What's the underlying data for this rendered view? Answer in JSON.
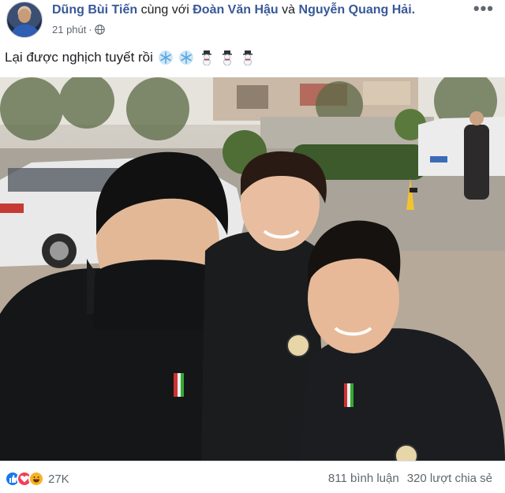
{
  "post": {
    "author": "Dũng Bùi Tiến",
    "with_text": "cùng với",
    "tagged_1": "Đoàn Văn Hậu",
    "and_text": "và",
    "tagged_2": "Nguyễn Quang Hải.",
    "time": "21 phút",
    "privacy_icon": "globe-icon",
    "more_icon": "more-options-icon",
    "text": "Lại được nghịch tuyết rồi",
    "emojis": [
      "snowflake-icon",
      "snowflake-icon",
      "snowman-icon",
      "snowman-icon",
      "snowman-icon"
    ]
  },
  "photo": {
    "description_icon": "selfie-photo"
  },
  "footer": {
    "reactions": [
      "like-icon",
      "love-icon",
      "haha-icon"
    ],
    "reaction_count": "27K",
    "comments": "811 bình luận",
    "shares": "320 lượt chia sẻ"
  },
  "colors": {
    "link": "#385898",
    "muted": "#606770",
    "like": "#1877f2",
    "love": "#f33e58",
    "haha": "#f7b125"
  }
}
